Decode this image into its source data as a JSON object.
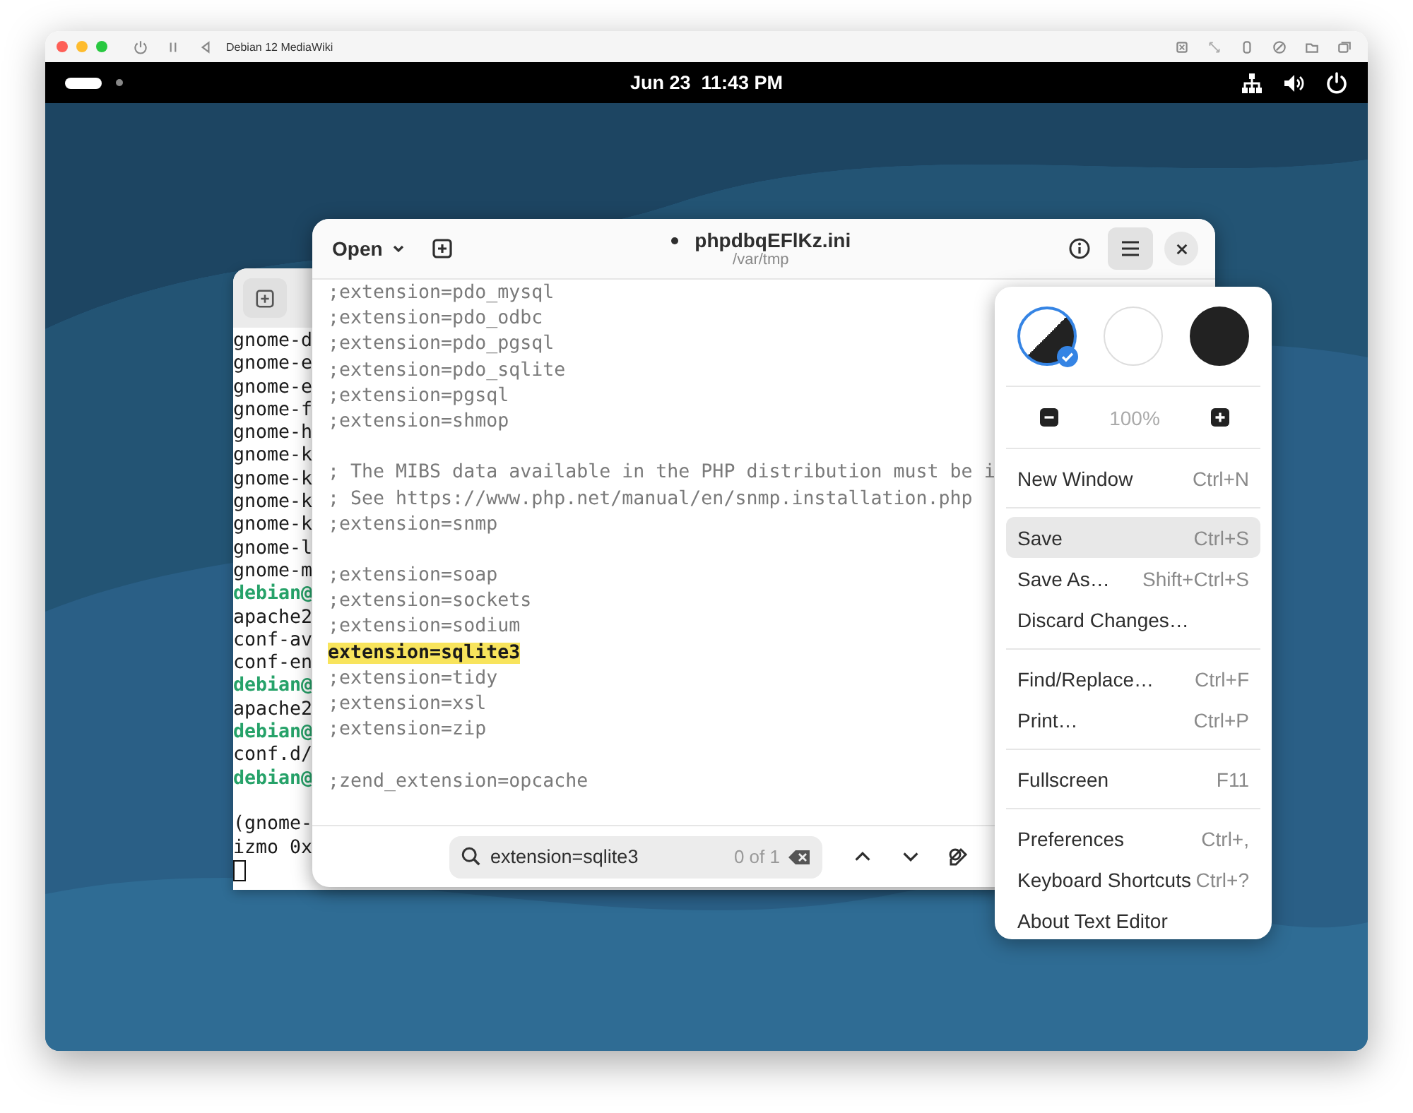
{
  "vm_window": {
    "title": "Debian 12 MediaWiki"
  },
  "top_bar": {
    "date": "Jun 23",
    "time": "11:43 PM"
  },
  "terminal": {
    "lines": [
      {
        "kind": "output",
        "text": "gnome-d"
      },
      {
        "kind": "output",
        "text": "gnome-e"
      },
      {
        "kind": "output",
        "text": "gnome-e"
      },
      {
        "kind": "output",
        "text": "gnome-f"
      },
      {
        "kind": "output",
        "text": "gnome-h"
      },
      {
        "kind": "output",
        "text": "gnome-k"
      },
      {
        "kind": "output",
        "text": "gnome-k"
      },
      {
        "kind": "output",
        "text": "gnome-k"
      },
      {
        "kind": "output",
        "text": "gnome-k"
      },
      {
        "kind": "output",
        "text": "gnome-l"
      },
      {
        "kind": "output",
        "text": "gnome-m"
      },
      {
        "kind": "prompt",
        "text": "debian@"
      },
      {
        "kind": "output",
        "text": "apache2"
      },
      {
        "kind": "output",
        "text": "conf-av"
      },
      {
        "kind": "output",
        "text": "conf-en"
      },
      {
        "kind": "prompt",
        "text": "debian@"
      },
      {
        "kind": "output",
        "text": "apache2"
      },
      {
        "kind": "prompt",
        "text": "debian@"
      },
      {
        "kind": "output",
        "text": "conf.d/"
      },
      {
        "kind": "prompt",
        "text": "debian@"
      },
      {
        "kind": "blank"
      },
      {
        "kind": "output",
        "text": "(gnome-"
      },
      {
        "kind": "output",
        "text": "izmo 0x"
      },
      {
        "kind": "cursor"
      }
    ]
  },
  "editor": {
    "open_label": "Open",
    "title": "phpdbqEFlKz.ini",
    "modified": true,
    "subtitle": "/var/tmp",
    "menu_open": true,
    "lines": [
      {
        "kind": "text",
        "text": ";extension=pdo_mysql"
      },
      {
        "kind": "text",
        "text": ";extension=pdo_odbc"
      },
      {
        "kind": "text",
        "text": ";extension=pdo_pgsql"
      },
      {
        "kind": "text",
        "text": ";extension=pdo_sqlite"
      },
      {
        "kind": "text",
        "text": ";extension=pgsql"
      },
      {
        "kind": "text",
        "text": ";extension=shmop"
      },
      {
        "kind": "blank"
      },
      {
        "kind": "text",
        "text": "; The MIBS data available in the PHP distribution must be i"
      },
      {
        "kind": "text",
        "text": "; See https://www.php.net/manual/en/snmp.installation.php"
      },
      {
        "kind": "text",
        "text": ";extension=snmp"
      },
      {
        "kind": "blank"
      },
      {
        "kind": "text",
        "text": ";extension=soap"
      },
      {
        "kind": "text",
        "text": ";extension=sockets"
      },
      {
        "kind": "text",
        "text": ";extension=sodium"
      },
      {
        "kind": "match",
        "text": "extension=sqlite3"
      },
      {
        "kind": "text",
        "text": ";extension=tidy"
      },
      {
        "kind": "text",
        "text": ";extension=xsl"
      },
      {
        "kind": "text",
        "text": ";extension=zip"
      },
      {
        "kind": "blank"
      },
      {
        "kind": "text",
        "text": ";zend_extension=opcache"
      }
    ],
    "search": {
      "value": "extension=sqlite3",
      "count": "0 of 1"
    }
  },
  "menu": {
    "styles": [
      {
        "kind": "system",
        "selected": true
      },
      {
        "kind": "light",
        "selected": false
      },
      {
        "kind": "dark",
        "selected": false
      }
    ],
    "zoom": "100%",
    "sections": [
      [
        {
          "label": "New Window",
          "shortcut": "Ctrl+N",
          "hovered": false
        }
      ],
      [
        {
          "label": "Save",
          "shortcut": "Ctrl+S",
          "hovered": true
        },
        {
          "label": "Save As…",
          "shortcut": "Shift+Ctrl+S",
          "hovered": false
        },
        {
          "label": "Discard Changes…",
          "hovered": false
        }
      ],
      [
        {
          "label": "Find/Replace…",
          "shortcut": "Ctrl+F",
          "hovered": false
        },
        {
          "label": "Print…",
          "shortcut": "Ctrl+P",
          "hovered": false
        }
      ],
      [
        {
          "label": "Fullscreen",
          "shortcut": "F11",
          "hovered": false
        }
      ],
      [
        {
          "label": "Preferences",
          "shortcut": "Ctrl+,",
          "hovered": false
        },
        {
          "label": "Keyboard Shortcuts",
          "shortcut": "Ctrl+?",
          "hovered": false
        },
        {
          "label": "About Text Editor",
          "hovered": false
        }
      ]
    ]
  }
}
